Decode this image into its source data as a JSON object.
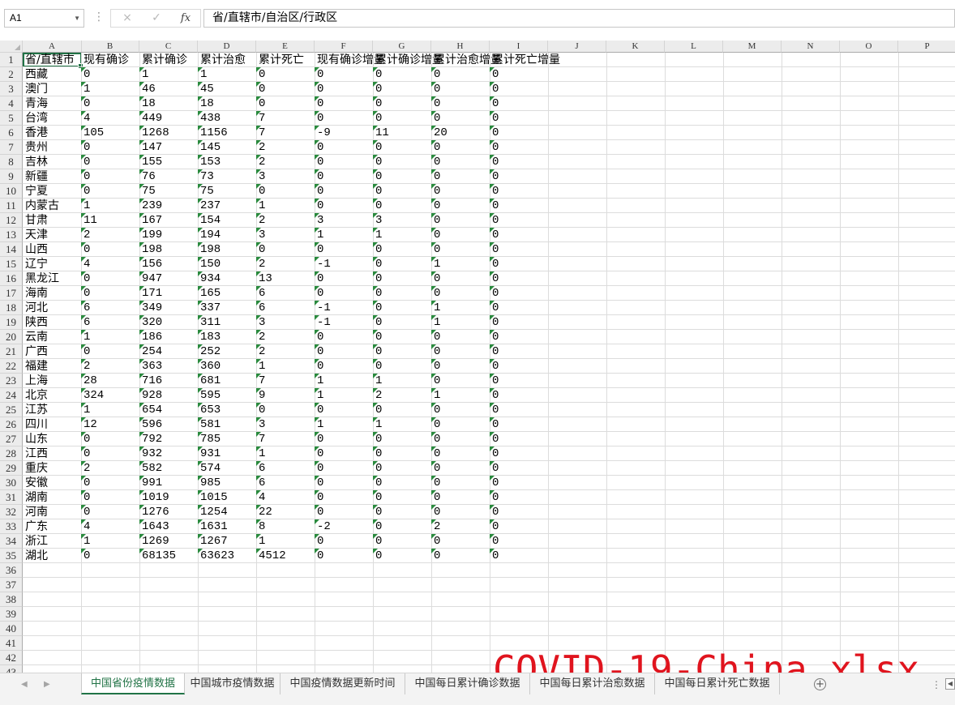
{
  "formula_bar": {
    "name_box": "A1",
    "cancel_icon": "×",
    "enter_icon": "✓",
    "fx_label": "fx",
    "formula_value": "省/直辖市/自治区/行政区"
  },
  "columns": [
    "A",
    "B",
    "C",
    "D",
    "E",
    "F",
    "G",
    "H",
    "I",
    "J",
    "K",
    "L",
    "M",
    "N",
    "O",
    "P"
  ],
  "headers": [
    "省/直辖市",
    "现有确诊",
    "累计确诊",
    "累计治愈",
    "累计死亡",
    "现有确诊增量",
    "累计确诊增量",
    "累计治愈增量",
    "累计死亡增量"
  ],
  "rows": [
    [
      "西藏",
      "0",
      "1",
      "1",
      "0",
      "0",
      "0",
      "0",
      "0"
    ],
    [
      "澳门",
      "1",
      "46",
      "45",
      "0",
      "0",
      "0",
      "0",
      "0"
    ],
    [
      "青海",
      "0",
      "18",
      "18",
      "0",
      "0",
      "0",
      "0",
      "0"
    ],
    [
      "台湾",
      "4",
      "449",
      "438",
      "7",
      "0",
      "0",
      "0",
      "0"
    ],
    [
      "香港",
      "105",
      "1268",
      "1156",
      "7",
      "-9",
      "11",
      "20",
      "0"
    ],
    [
      "贵州",
      "0",
      "147",
      "145",
      "2",
      "0",
      "0",
      "0",
      "0"
    ],
    [
      "吉林",
      "0",
      "155",
      "153",
      "2",
      "0",
      "0",
      "0",
      "0"
    ],
    [
      "新疆",
      "0",
      "76",
      "73",
      "3",
      "0",
      "0",
      "0",
      "0"
    ],
    [
      "宁夏",
      "0",
      "75",
      "75",
      "0",
      "0",
      "0",
      "0",
      "0"
    ],
    [
      "内蒙古",
      "1",
      "239",
      "237",
      "1",
      "0",
      "0",
      "0",
      "0"
    ],
    [
      "甘肃",
      "11",
      "167",
      "154",
      "2",
      "3",
      "3",
      "0",
      "0"
    ],
    [
      "天津",
      "2",
      "199",
      "194",
      "3",
      "1",
      "1",
      "0",
      "0"
    ],
    [
      "山西",
      "0",
      "198",
      "198",
      "0",
      "0",
      "0",
      "0",
      "0"
    ],
    [
      "辽宁",
      "4",
      "156",
      "150",
      "2",
      "-1",
      "0",
      "1",
      "0"
    ],
    [
      "黑龙江",
      "0",
      "947",
      "934",
      "13",
      "0",
      "0",
      "0",
      "0"
    ],
    [
      "海南",
      "0",
      "171",
      "165",
      "6",
      "0",
      "0",
      "0",
      "0"
    ],
    [
      "河北",
      "6",
      "349",
      "337",
      "6",
      "-1",
      "0",
      "1",
      "0"
    ],
    [
      "陕西",
      "6",
      "320",
      "311",
      "3",
      "-1",
      "0",
      "1",
      "0"
    ],
    [
      "云南",
      "1",
      "186",
      "183",
      "2",
      "0",
      "0",
      "0",
      "0"
    ],
    [
      "广西",
      "0",
      "254",
      "252",
      "2",
      "0",
      "0",
      "0",
      "0"
    ],
    [
      "福建",
      "2",
      "363",
      "360",
      "1",
      "0",
      "0",
      "0",
      "0"
    ],
    [
      "上海",
      "28",
      "716",
      "681",
      "7",
      "1",
      "1",
      "0",
      "0"
    ],
    [
      "北京",
      "324",
      "928",
      "595",
      "9",
      "1",
      "2",
      "1",
      "0"
    ],
    [
      "江苏",
      "1",
      "654",
      "653",
      "0",
      "0",
      "0",
      "0",
      "0"
    ],
    [
      "四川",
      "12",
      "596",
      "581",
      "3",
      "1",
      "1",
      "0",
      "0"
    ],
    [
      "山东",
      "0",
      "792",
      "785",
      "7",
      "0",
      "0",
      "0",
      "0"
    ],
    [
      "江西",
      "0",
      "932",
      "931",
      "1",
      "0",
      "0",
      "0",
      "0"
    ],
    [
      "重庆",
      "2",
      "582",
      "574",
      "6",
      "0",
      "0",
      "0",
      "0"
    ],
    [
      "安徽",
      "0",
      "991",
      "985",
      "6",
      "0",
      "0",
      "0",
      "0"
    ],
    [
      "湖南",
      "0",
      "1019",
      "1015",
      "4",
      "0",
      "0",
      "0",
      "0"
    ],
    [
      "河南",
      "0",
      "1276",
      "1254",
      "22",
      "0",
      "0",
      "0",
      "0"
    ],
    [
      "广东",
      "4",
      "1643",
      "1631",
      "8",
      "-2",
      "0",
      "2",
      "0"
    ],
    [
      "浙江",
      "1",
      "1269",
      "1267",
      "1",
      "0",
      "0",
      "0",
      "0"
    ],
    [
      "湖北",
      "0",
      "68135",
      "63623",
      "4512",
      "0",
      "0",
      "0",
      "0"
    ]
  ],
  "watermark": "COVID-19-China.xlsx",
  "sheet_tabs": [
    "中国省份疫情数据",
    "中国城市疫情数据",
    "中国疫情数据更新时间",
    "中国每日累计确诊数据",
    "中国每日累计治愈数据",
    "中国每日累计死亡数据"
  ],
  "active_tab": 0,
  "colors": {
    "accent": "#217346",
    "watermark": "#e0141e",
    "error_triangle": "#2a8a3e"
  }
}
